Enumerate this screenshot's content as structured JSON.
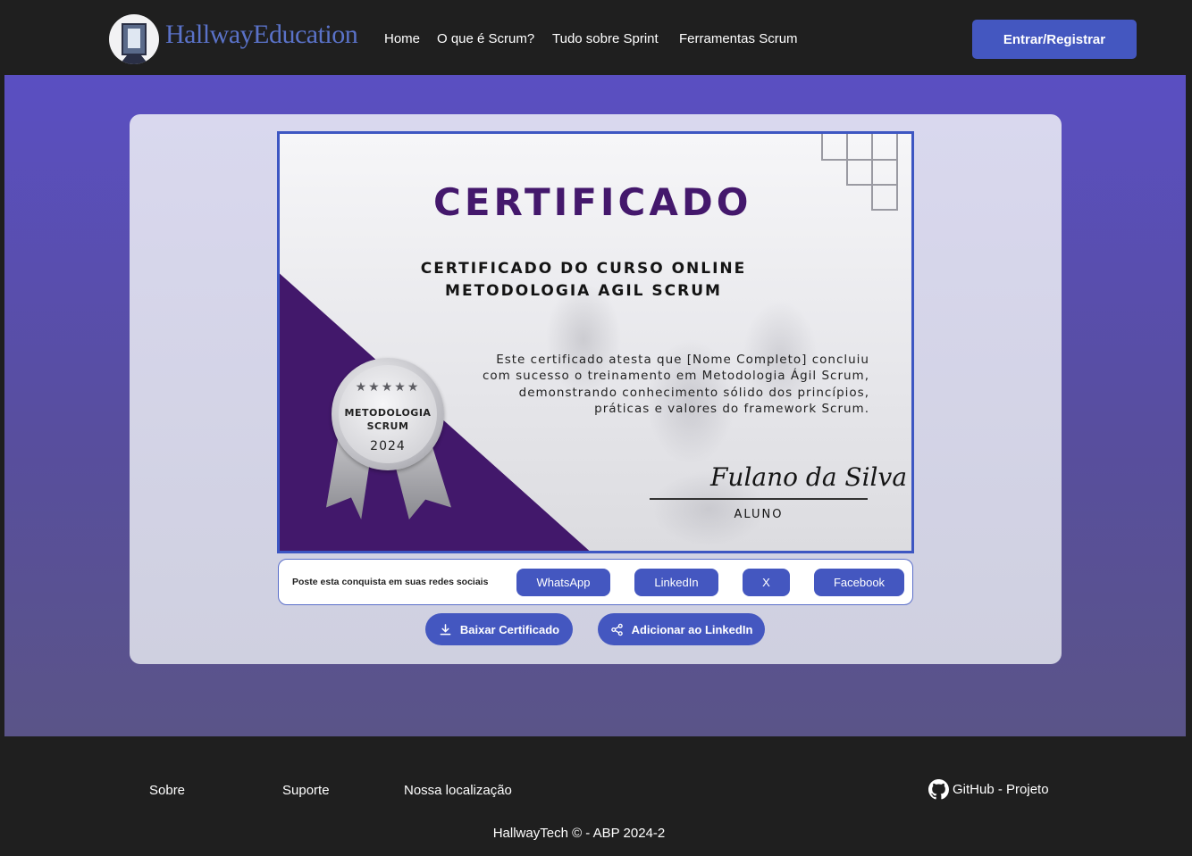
{
  "header": {
    "brand": "HallwayEducation",
    "nav": [
      "Home",
      "O que é Scrum?",
      "Tudo sobre Sprint",
      "Ferramentas Scrum"
    ],
    "login_label": "Entrar/Registrar"
  },
  "certificate": {
    "title": "CERTIFICADO",
    "subtitle_line1": "CERTIFICADO DO CURSO ONLINE",
    "subtitle_line2": "METODOLOGIA AGIL SCRUM",
    "body_lines": [
      "Este certificado atesta que [Nome Completo] concluiu",
      "com sucesso o treinamento em Metodologia Ágil Scrum,",
      "demonstrando conhecimento sólido dos princípios,",
      "práticas e valores do framework Scrum."
    ],
    "signature": "Fulano da Silva",
    "signature_role": "ALUNO",
    "medal": {
      "stars": "★★★★★",
      "line1": "METODOLOGIA",
      "line2": "SCRUM",
      "year": "2024"
    }
  },
  "share": {
    "label": "Poste esta conquista em suas redes sociais",
    "buttons": [
      "WhatsApp",
      "LinkedIn",
      "X",
      "Facebook"
    ]
  },
  "actions": {
    "download_label": "Baixar Certificado",
    "linkedin_label": "Adicionar ao LinkedIn"
  },
  "footer": {
    "links": [
      "Sobre",
      "Suporte",
      "Nossa localização"
    ],
    "github_label": "GitHub - Projeto",
    "copyright": "HallwayTech © - ABP 2024-2"
  },
  "colors": {
    "accent": "#4457c0",
    "certificate_purple": "#42186b",
    "background_top": "#5a4fc2",
    "header_bg": "#1f1f1f"
  }
}
